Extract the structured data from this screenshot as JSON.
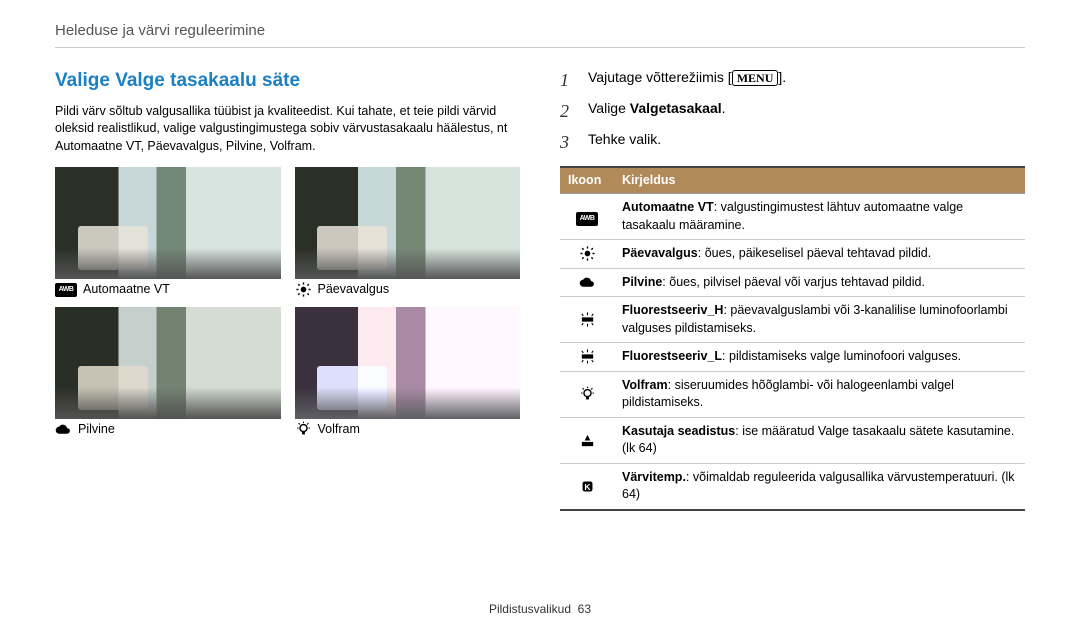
{
  "header": "Heleduse ja värvi reguleerimine",
  "section_title": "Valige Valge tasakaalu säte",
  "intro": "Pildi värv sõltub valgusallika tüübist ja kvaliteedist. Kui tahate, et teie pildi värvid oleksid realistlikud, valige valgustingimustega sobiv värvustasakaalu häälestus, nt Automaatne VT, Päevavalgus, Pilvine, Volfram.",
  "captions": {
    "awb": "Automaatne VT",
    "daylight": "Päevavalgus",
    "cloudy": "Pilvine",
    "tungsten": "Volfram"
  },
  "steps": {
    "s1a": "Vajutage võtterežiimis [",
    "s1b": "].",
    "s2a": "Valige ",
    "s2b": "Valgetasakaal",
    "s2c": ".",
    "s3": "Tehke valik."
  },
  "menu_label": "MENU",
  "table": {
    "h1": "Ikoon",
    "h2": "Kirjeldus",
    "rows": [
      {
        "icon": "awb",
        "b": "Automaatne VT",
        "t": ": valgustingimustest lähtuv automaatne valge tasakaalu määramine."
      },
      {
        "icon": "sun",
        "b": "Päevavalgus",
        "t": ": õues, päikeselisel päeval tehtavad pildid."
      },
      {
        "icon": "cloud",
        "b": "Pilvine",
        "t": ": õues, pilvisel päeval või varjus tehtavad pildid."
      },
      {
        "icon": "fluor",
        "b": "Fluorestseeriv_H",
        "t": ": päevavalguslambi või 3-kanalilise luminofoorlambi valguses pildistamiseks."
      },
      {
        "icon": "fluor",
        "b": "Fluorestseeriv_L",
        "t": ": pildistamiseks valge luminofoori valguses."
      },
      {
        "icon": "bulb",
        "b": "Volfram",
        "t": ": siseruumides hõõglambi- või halogeenlambi valgel pildistamiseks."
      },
      {
        "icon": "gear",
        "b": "Kasutaja seadistus",
        "t": ": ise määratud Valge tasakaalu sätete kasutamine. (lk 64)"
      },
      {
        "icon": "ktemp",
        "b": "Värvitemp.",
        "t": ": võimaldab reguleerida valgusallika värvustemperatuuri. (lk 64)"
      }
    ]
  },
  "footer": {
    "label": "Pildistusvalikud",
    "page": "63"
  }
}
